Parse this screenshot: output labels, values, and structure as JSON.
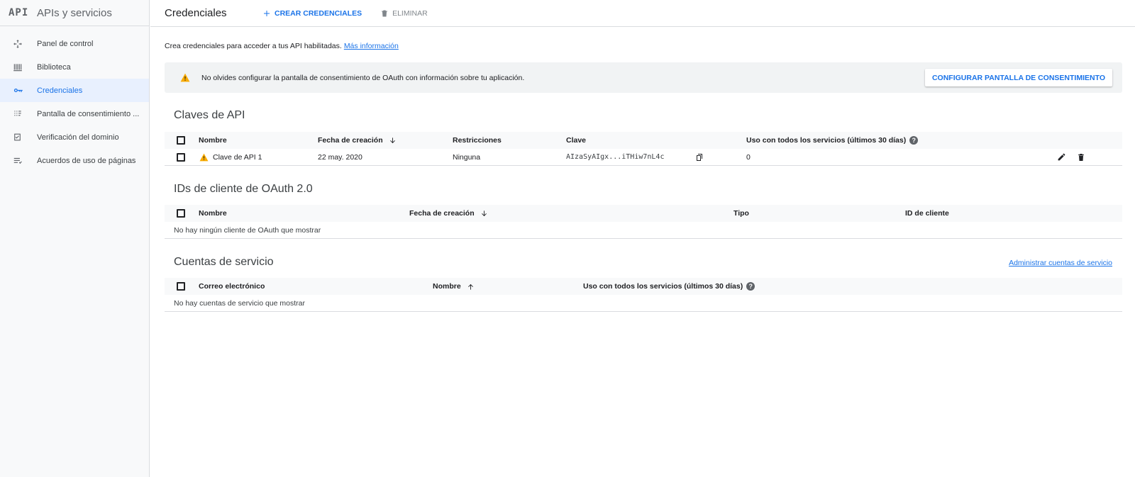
{
  "sidebar": {
    "logo": "API",
    "title": "APIs y servicios",
    "items": [
      {
        "label": "Panel de control",
        "icon": "dashboard-icon"
      },
      {
        "label": "Biblioteca",
        "icon": "library-icon"
      },
      {
        "label": "Credenciales",
        "icon": "key-icon",
        "active": true
      },
      {
        "label": "Pantalla de consentimiento ...",
        "icon": "consent-icon"
      },
      {
        "label": "Verificación del dominio",
        "icon": "verify-icon"
      },
      {
        "label": "Acuerdos de uso de páginas",
        "icon": "agreements-icon"
      }
    ]
  },
  "header": {
    "title": "Credenciales",
    "create_label": "CREAR CREDENCIALES",
    "delete_label": "ELIMINAR"
  },
  "intro": {
    "text": "Crea credenciales para acceder a tus API habilitadas.",
    "link": "Más información"
  },
  "banner": {
    "text": "No olvides configurar la pantalla de consentimiento de OAuth con información sobre tu aplicación.",
    "button": "CONFIGURAR PANTALLA DE CONSENTIMIENTO"
  },
  "api_keys": {
    "title": "Claves de API",
    "columns": [
      "Nombre",
      "Fecha de creación",
      "Restricciones",
      "Clave",
      "Uso con todos los servicios (últimos 30 días)"
    ],
    "rows": [
      {
        "name": "Clave de API 1",
        "created": "22 may. 2020",
        "restrictions": "Ninguna",
        "key": "AIzaSyAIgx...iTHiw7nL4c",
        "usage": "0"
      }
    ]
  },
  "oauth": {
    "title": "IDs de cliente de OAuth 2.0",
    "columns": [
      "Nombre",
      "Fecha de creación",
      "Tipo",
      "ID de cliente"
    ],
    "empty": "No hay ningún cliente de OAuth que mostrar"
  },
  "service_accounts": {
    "title": "Cuentas de servicio",
    "manage_link": "Administrar cuentas de servicio",
    "columns": [
      "Correo electrónico",
      "Nombre",
      "Uso con todos los servicios (últimos 30 días)"
    ],
    "empty": "No hay cuentas de servicio que mostrar"
  },
  "colors": {
    "accent": "#1a73e8",
    "warning": "#f9ab00"
  }
}
